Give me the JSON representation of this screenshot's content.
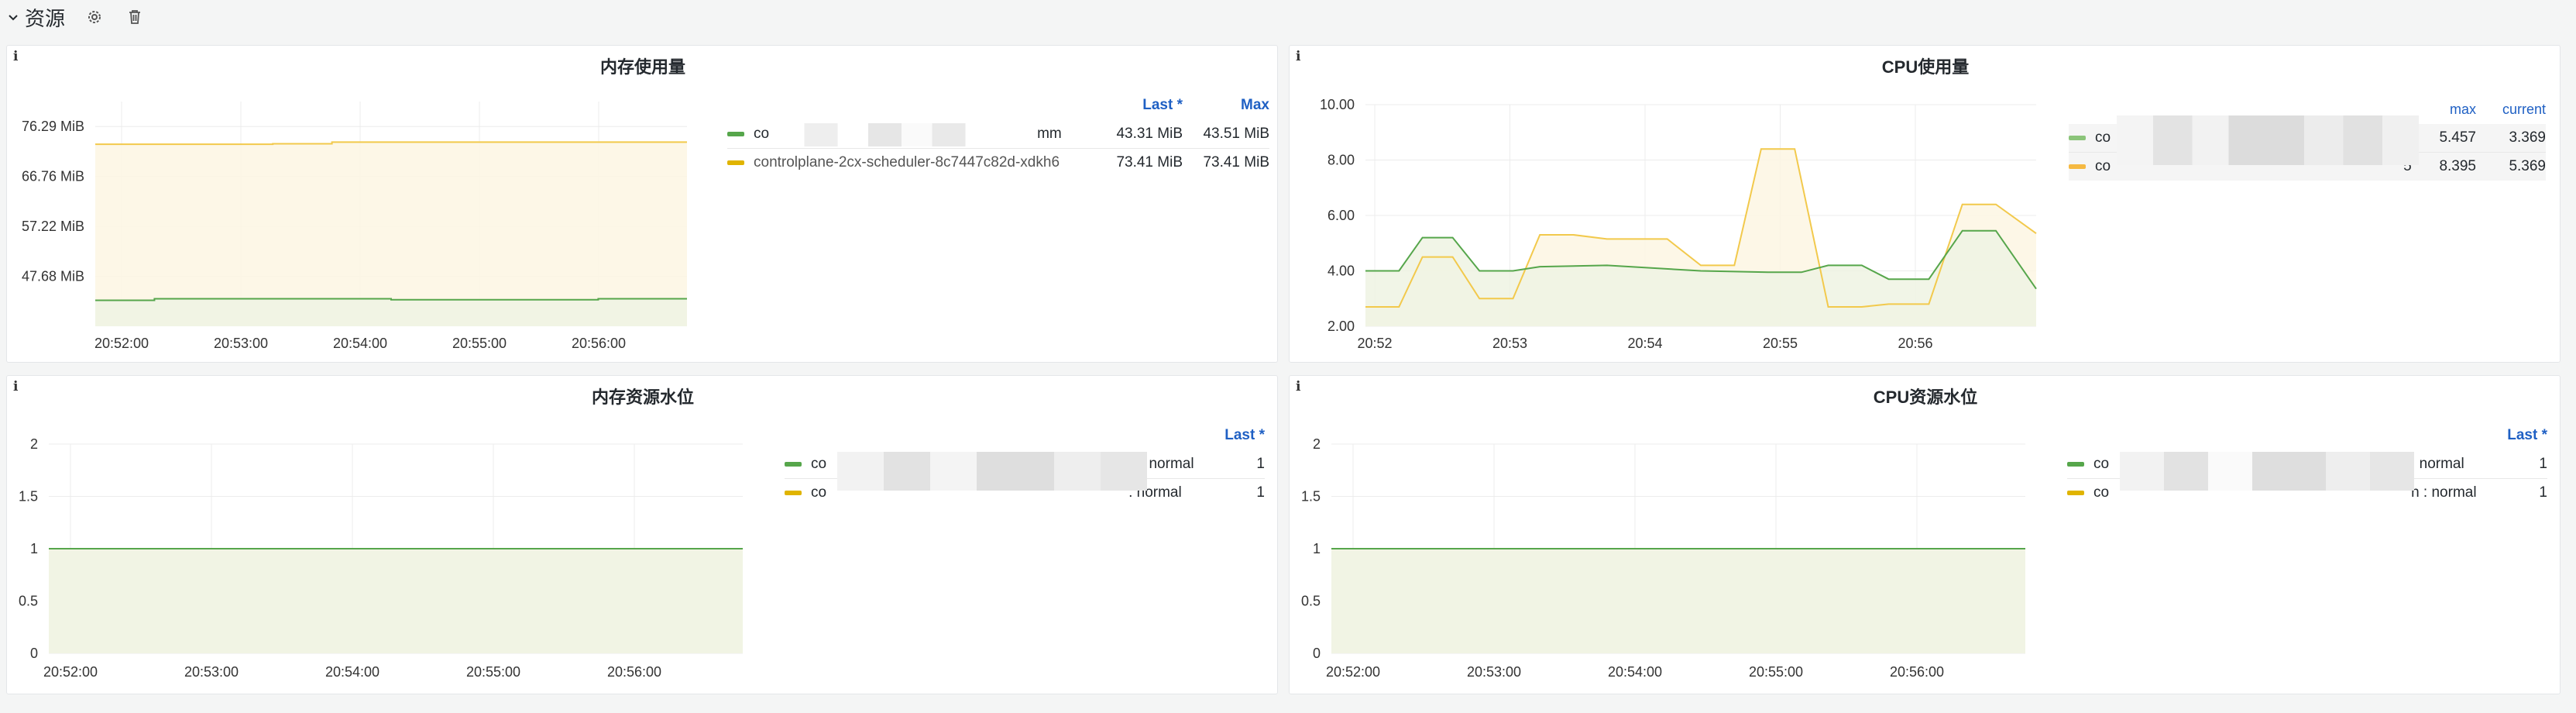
{
  "row": {
    "title": "资源",
    "chevron": "⌄",
    "icons": [
      "gear-icon",
      "trash-icon"
    ]
  },
  "colors": {
    "green": "#56a64b",
    "yellow": "#f2c94c",
    "green_fill": "#eef3e3",
    "yellow_fill": "#fdf6e3",
    "header_blue": "#1f60c4"
  },
  "panels": {
    "mem_usage": {
      "info": "i",
      "title": "内存使用量",
      "legend": {
        "headers": [
          "Last *",
          "Max"
        ],
        "rows": [
          {
            "label_start": "co",
            "label_end": "mm",
            "color": "green",
            "values": [
              "43.31 MiB",
              "43.51 MiB"
            ]
          },
          {
            "label_start": "controlplane-2cx-scheduler-8c7447c82d-xdkh6",
            "label_end": "",
            "color": "yellow",
            "values": [
              "73.41 MiB",
              "73.41 MiB"
            ]
          }
        ]
      }
    },
    "cpu_usage": {
      "info": "i",
      "title": "CPU使用量",
      "legend": {
        "headers": [
          "max",
          "current"
        ],
        "rows": [
          {
            "label_start": "co",
            "label_end": "n",
            "color": "green",
            "values": [
              "5.457",
              "3.369"
            ]
          },
          {
            "label_start": "co",
            "label_end": "5",
            "color": "yellow",
            "values": [
              "8.395",
              "5.369"
            ]
          }
        ]
      }
    },
    "mem_level": {
      "info": "i",
      "title": "内存资源水位",
      "legend": {
        "headers": [
          "Last *"
        ],
        "rows": [
          {
            "label_start": "co",
            "label_end": "n : normal",
            "color": "green",
            "values": [
              "1"
            ]
          },
          {
            "label_start": "co",
            "label_end": ": normal",
            "color": "yellow",
            "values": [
              "1"
            ]
          }
        ]
      }
    },
    "cpu_level": {
      "info": "i",
      "title": "CPU资源水位",
      "legend": {
        "headers": [
          "Last *"
        ],
        "rows": [
          {
            "label_start": "co",
            "label_end": ": normal",
            "color": "green",
            "values": [
              "1"
            ]
          },
          {
            "label_start": "co",
            "label_end": "n : normal",
            "color": "yellow",
            "values": [
              "1"
            ]
          }
        ]
      }
    }
  },
  "chart_data": [
    {
      "id": "mem_usage",
      "type": "area",
      "title": "内存使用量",
      "y_ticks": [
        "47.68 MiB",
        "57.22 MiB",
        "66.76 MiB",
        "76.29 MiB"
      ],
      "x_ticks": [
        "20:52:00",
        "20:53:00",
        "20:54:00",
        "20:55:00",
        "20:56:00"
      ],
      "x_range": [
        0,
        1
      ],
      "ylim": [
        38.14,
        81.06
      ],
      "series": [
        {
          "color": "green",
          "points": [
            [
              0,
              43.1
            ],
            [
              0.1,
              43.1
            ],
            [
              0.1,
              43.4
            ],
            [
              0.5,
              43.4
            ],
            [
              0.5,
              43.2
            ],
            [
              0.85,
              43.2
            ],
            [
              0.85,
              43.4
            ],
            [
              1,
              43.4
            ]
          ]
        },
        {
          "color": "yellow",
          "points": [
            [
              0,
              72.9
            ],
            [
              0.3,
              72.9
            ],
            [
              0.3,
              73.0
            ],
            [
              0.4,
              73.0
            ],
            [
              0.4,
              73.3
            ],
            [
              1,
              73.3
            ]
          ]
        }
      ]
    },
    {
      "id": "cpu_usage",
      "type": "area",
      "title": "CPU使用量",
      "y_ticks": [
        "2.00",
        "4.00",
        "6.00",
        "8.00",
        "10.00"
      ],
      "x_ticks": [
        "20:52",
        "20:53",
        "20:54",
        "20:55",
        "20:56"
      ],
      "x_range": [
        0,
        1
      ],
      "ylim": [
        2,
        10
      ],
      "series": [
        {
          "color": "green",
          "points": [
            [
              0,
              4.0
            ],
            [
              0.05,
              4.0
            ],
            [
              0.085,
              5.2
            ],
            [
              0.13,
              5.2
            ],
            [
              0.17,
              4.0
            ],
            [
              0.22,
              4.0
            ],
            [
              0.26,
              4.15
            ],
            [
              0.36,
              4.2
            ],
            [
              0.5,
              4.0
            ],
            [
              0.6,
              3.95
            ],
            [
              0.65,
              3.95
            ],
            [
              0.69,
              4.2
            ],
            [
              0.74,
              4.2
            ],
            [
              0.78,
              3.7
            ],
            [
              0.84,
              3.7
            ],
            [
              0.89,
              5.45
            ],
            [
              0.94,
              5.45
            ],
            [
              1,
              3.35
            ]
          ]
        },
        {
          "color": "yellow",
          "points": [
            [
              0,
              2.7
            ],
            [
              0.05,
              2.7
            ],
            [
              0.085,
              4.5
            ],
            [
              0.13,
              4.5
            ],
            [
              0.17,
              3.0
            ],
            [
              0.22,
              3.0
            ],
            [
              0.26,
              5.3
            ],
            [
              0.31,
              5.3
            ],
            [
              0.36,
              5.15
            ],
            [
              0.45,
              5.15
            ],
            [
              0.5,
              4.2
            ],
            [
              0.55,
              4.2
            ],
            [
              0.59,
              8.4
            ],
            [
              0.64,
              8.4
            ],
            [
              0.69,
              2.7
            ],
            [
              0.74,
              2.7
            ],
            [
              0.78,
              2.8
            ],
            [
              0.84,
              2.8
            ],
            [
              0.89,
              6.4
            ],
            [
              0.94,
              6.4
            ],
            [
              1,
              5.35
            ]
          ]
        }
      ]
    },
    {
      "id": "mem_level",
      "type": "area",
      "title": "内存资源水位",
      "y_ticks": [
        "0",
        "0.5",
        "1",
        "1.5",
        "2"
      ],
      "x_ticks": [
        "20:52:00",
        "20:53:00",
        "20:54:00",
        "20:55:00",
        "20:56:00"
      ],
      "x_range": [
        0,
        1
      ],
      "ylim": [
        0,
        2
      ],
      "series": [
        {
          "color": "green",
          "points": [
            [
              0,
              1
            ],
            [
              1,
              1
            ]
          ]
        },
        {
          "color": "yellow",
          "points": [
            [
              0,
              1
            ],
            [
              1,
              1
            ]
          ]
        }
      ]
    },
    {
      "id": "cpu_level",
      "type": "area",
      "title": "CPU资源水位",
      "y_ticks": [
        "0",
        "0.5",
        "1",
        "1.5",
        "2"
      ],
      "x_ticks": [
        "20:52:00",
        "20:53:00",
        "20:54:00",
        "20:55:00",
        "20:56:00"
      ],
      "x_range": [
        0,
        1
      ],
      "ylim": [
        0,
        2
      ],
      "series": [
        {
          "color": "green",
          "points": [
            [
              0,
              1
            ],
            [
              1,
              1
            ]
          ]
        },
        {
          "color": "yellow",
          "points": [
            [
              0,
              1
            ],
            [
              1,
              1
            ]
          ]
        }
      ]
    }
  ]
}
